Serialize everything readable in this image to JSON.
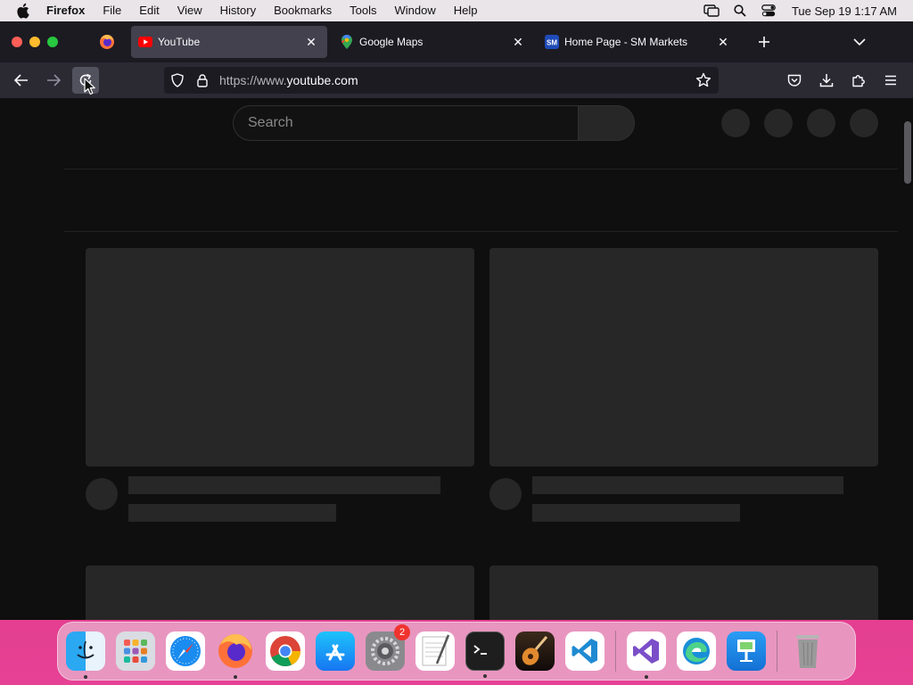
{
  "menubar": {
    "app_name": "Firefox",
    "items": [
      "File",
      "Edit",
      "View",
      "History",
      "Bookmarks",
      "Tools",
      "Window",
      "Help"
    ],
    "clock": "Tue Sep 19  1:17 AM"
  },
  "tabs": [
    {
      "title": "YouTube",
      "icon": "youtube-favicon",
      "active": true
    },
    {
      "title": "Google Maps",
      "icon": "google-maps-favicon",
      "active": false
    },
    {
      "title": "Home Page - SM Markets",
      "icon": "sm-markets-favicon",
      "active": false
    }
  ],
  "urlbar": {
    "url_prefix": "https://www.",
    "url_domain": "youtube.com"
  },
  "youtube": {
    "search_placeholder": "Search"
  },
  "dock": {
    "apps": [
      "Finder",
      "Launchpad",
      "Safari",
      "Firefox",
      "Google Chrome",
      "App Store",
      "System Settings",
      "TextEdit",
      "Terminal",
      "GarageBand",
      "Visual Studio Code",
      "Visual Studio",
      "Microsoft Edge",
      "Keynote",
      "Trash"
    ],
    "system_settings_badge": "2"
  },
  "colors": {
    "browser_chrome": "#1c1b22",
    "toolbar": "#2b2a33",
    "page_background": "#0f0f0f",
    "skeleton": "#272727",
    "desktop_pink": "#d8357f"
  }
}
